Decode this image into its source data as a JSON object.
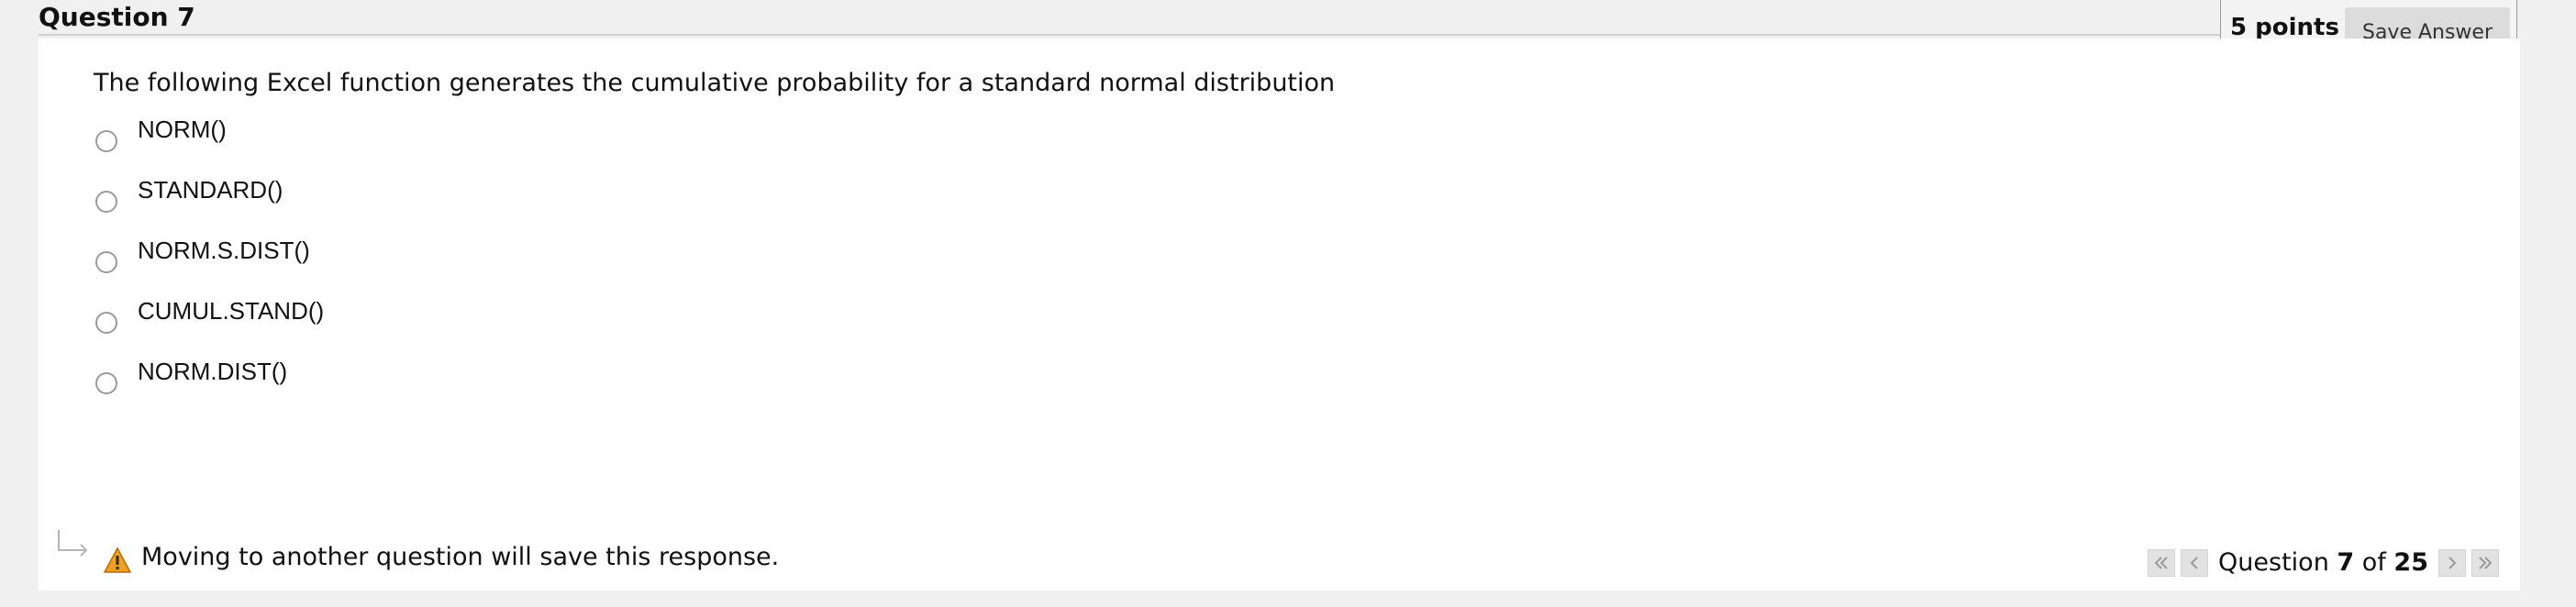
{
  "question": {
    "title": "Question 7",
    "points": "5 points",
    "save_label": "Save Answer",
    "text": "The following Excel function generates the cumulative probability for a standard normal distribution",
    "options": [
      "NORM()",
      "STANDARD()",
      "NORM.S.DIST()",
      "CUMUL.STAND()",
      "NORM.DIST()"
    ]
  },
  "footer": {
    "warning": "Moving to another question will save this response.",
    "pager": {
      "prefix": "Question",
      "current": "7",
      "of": "of",
      "total": "25"
    }
  },
  "icons": {
    "first": "double-chevron-left-icon",
    "prev": "chevron-left-icon",
    "next": "chevron-right-icon",
    "last": "double-chevron-right-icon",
    "warning": "warning-triangle-icon",
    "arrow": "return-arrow-icon"
  },
  "colors": {
    "warning": "#f0a020",
    "background": "#f0f0f0",
    "card": "#ffffff"
  }
}
